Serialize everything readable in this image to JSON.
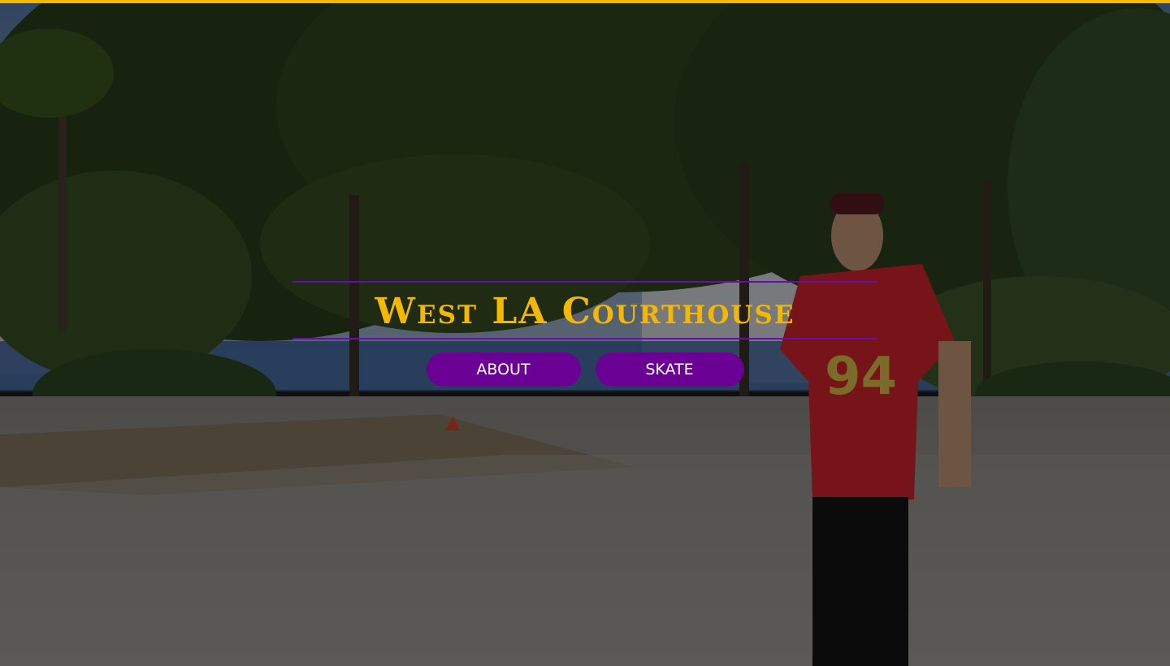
{
  "site": {
    "title": "West LA Courthouse"
  },
  "nav": {
    "items": [
      {
        "label": "ABOUT"
      },
      {
        "label": "SKATE"
      }
    ]
  },
  "hero": {
    "background": "video-frame-skatepark",
    "overlay": "dark"
  },
  "colors": {
    "accent_gold": "#f5b800",
    "accent_purple": "#6a0094",
    "rule_purple": "#6a0dad",
    "button_text": "#ffffff"
  }
}
